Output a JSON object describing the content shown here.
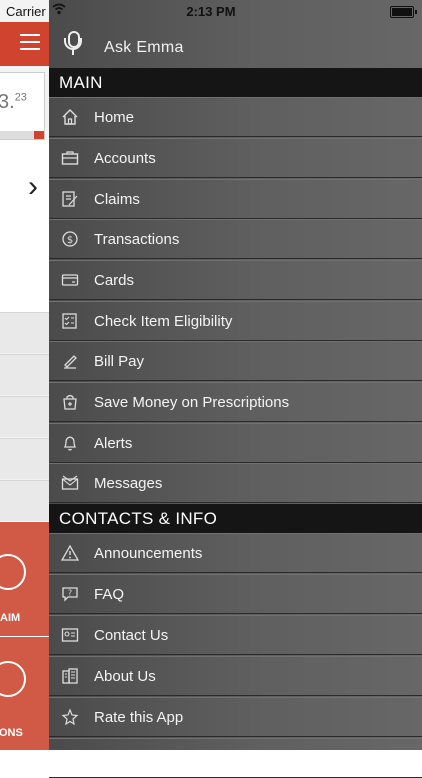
{
  "status_bar": {
    "carrier": "Carrier",
    "time": "2:13 PM"
  },
  "background_app": {
    "balance_main": "3.",
    "balance_cents": "23",
    "tile_labels": [
      "AIM",
      "ONS"
    ]
  },
  "menu": {
    "ask_label": "Ask Emma",
    "sections": [
      {
        "title": "MAIN",
        "items": [
          {
            "label": "Home",
            "icon": "home-icon"
          },
          {
            "label": "Accounts",
            "icon": "briefcase-icon"
          },
          {
            "label": "Claims",
            "icon": "claim-form-icon"
          },
          {
            "label": "Transactions",
            "icon": "dollar-circle-icon"
          },
          {
            "label": "Cards",
            "icon": "card-icon"
          },
          {
            "label": "Check Item Eligibility",
            "icon": "eligibility-checklist-icon"
          },
          {
            "label": "Bill Pay",
            "icon": "bill-pay-icon"
          },
          {
            "label": "Save Money on Prescriptions",
            "icon": "prescription-bag-icon"
          },
          {
            "label": "Alerts",
            "icon": "bell-icon"
          },
          {
            "label": "Messages",
            "icon": "envelope-icon"
          }
        ]
      },
      {
        "title": "CONTACTS & INFO",
        "items": [
          {
            "label": "Announcements",
            "icon": "warning-icon"
          },
          {
            "label": "FAQ",
            "icon": "question-chat-icon"
          },
          {
            "label": "Contact Us",
            "icon": "contact-card-icon"
          },
          {
            "label": "About Us",
            "icon": "building-icon"
          },
          {
            "label": "Rate this App",
            "icon": "star-hand-icon"
          }
        ]
      }
    ]
  },
  "colors": {
    "accent_red": "#d0432f",
    "menu_bg": "#5a5a5a",
    "section_bg": "#151515"
  }
}
